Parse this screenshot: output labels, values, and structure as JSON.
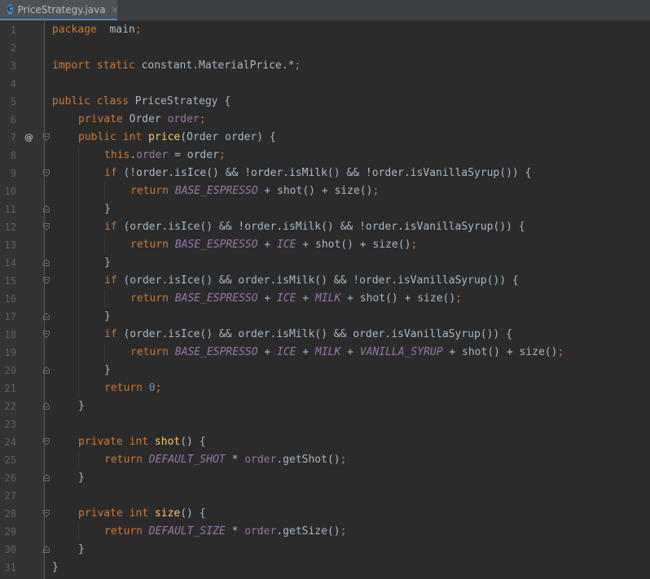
{
  "tab": {
    "icon_letter": "C",
    "title": "PriceStrategy.java",
    "close": "×"
  },
  "gutter": {
    "override_marker": "@"
  },
  "colors": {
    "background": "#2b2b2b",
    "keyword": "#cc7832",
    "method": "#ffc66d",
    "field": "#9876aa",
    "number": "#6897bb",
    "text": "#a9b7c6"
  },
  "lines": [
    {
      "n": "1",
      "indent": 0,
      "tokens": [
        [
          "kw",
          "package"
        ],
        [
          "",
          "  main"
        ],
        [
          "sym",
          ";"
        ]
      ]
    },
    {
      "n": "2",
      "indent": 0,
      "tokens": []
    },
    {
      "n": "3",
      "indent": 0,
      "tokens": [
        [
          "kw",
          "import static"
        ],
        [
          "",
          " constant.MaterialPrice.*"
        ],
        [
          "sym",
          ";"
        ]
      ]
    },
    {
      "n": "4",
      "indent": 0,
      "tokens": []
    },
    {
      "n": "5",
      "indent": 0,
      "tokens": [
        [
          "kw",
          "public class"
        ],
        [
          "",
          " PriceStrategy {"
        ]
      ]
    },
    {
      "n": "6",
      "indent": 1,
      "tokens": [
        [
          "kw",
          "private"
        ],
        [
          "",
          " Order "
        ],
        [
          "fld",
          "order"
        ],
        [
          "sym",
          ";"
        ]
      ]
    },
    {
      "n": "7",
      "indent": 1,
      "marker": "@",
      "fold": "open",
      "tokens": [
        [
          "kw",
          "public int"
        ],
        [
          "",
          " "
        ],
        [
          "fn",
          "price"
        ],
        [
          "",
          "(Order order) {"
        ]
      ]
    },
    {
      "n": "8",
      "indent": 2,
      "tokens": [
        [
          "kw",
          "this"
        ],
        [
          "",
          "."
        ],
        [
          "fld",
          "order"
        ],
        [
          "",
          " = order"
        ],
        [
          "sym",
          ";"
        ]
      ]
    },
    {
      "n": "9",
      "indent": 2,
      "fold": "open",
      "tokens": [
        [
          "kw",
          "if"
        ],
        [
          "",
          " (!order.isIce() && !order.isMilk() && !order.isVanillaSyrup()) {"
        ]
      ]
    },
    {
      "n": "10",
      "indent": 3,
      "tokens": [
        [
          "kw",
          "return"
        ],
        [
          "",
          " "
        ],
        [
          "const",
          "BASE_ESPRESSO"
        ],
        [
          "",
          " + shot() + size()"
        ],
        [
          "sym",
          ";"
        ]
      ]
    },
    {
      "n": "11",
      "indent": 2,
      "fold": "close",
      "tokens": [
        [
          "",
          "}"
        ]
      ]
    },
    {
      "n": "12",
      "indent": 2,
      "fold": "open",
      "tokens": [
        [
          "kw",
          "if"
        ],
        [
          "",
          " (order.isIce() && !order.isMilk() && !order.isVanillaSyrup()) {"
        ]
      ]
    },
    {
      "n": "13",
      "indent": 3,
      "tokens": [
        [
          "kw",
          "return"
        ],
        [
          "",
          " "
        ],
        [
          "const",
          "BASE_ESPRESSO"
        ],
        [
          "",
          " + "
        ],
        [
          "const",
          "ICE"
        ],
        [
          "",
          " + shot() + size()"
        ],
        [
          "sym",
          ";"
        ]
      ]
    },
    {
      "n": "14",
      "indent": 2,
      "fold": "close",
      "tokens": [
        [
          "",
          "}"
        ]
      ]
    },
    {
      "n": "15",
      "indent": 2,
      "fold": "open",
      "tokens": [
        [
          "kw",
          "if"
        ],
        [
          "",
          " (order.isIce() && order.isMilk() && !order.isVanillaSyrup()) {"
        ]
      ]
    },
    {
      "n": "16",
      "indent": 3,
      "tokens": [
        [
          "kw",
          "return"
        ],
        [
          "",
          " "
        ],
        [
          "const",
          "BASE_ESPRESSO"
        ],
        [
          "",
          " + "
        ],
        [
          "const",
          "ICE"
        ],
        [
          "",
          " + "
        ],
        [
          "const",
          "MILK"
        ],
        [
          "",
          " + shot() + size()"
        ],
        [
          "sym",
          ";"
        ]
      ]
    },
    {
      "n": "17",
      "indent": 2,
      "fold": "close",
      "tokens": [
        [
          "",
          "}"
        ]
      ]
    },
    {
      "n": "18",
      "indent": 2,
      "fold": "open",
      "tokens": [
        [
          "kw",
          "if"
        ],
        [
          "",
          " (order.isIce() && order.isMilk() && order.isVanillaSyrup()) {"
        ]
      ]
    },
    {
      "n": "19",
      "indent": 3,
      "tokens": [
        [
          "kw",
          "return"
        ],
        [
          "",
          " "
        ],
        [
          "const",
          "BASE_ESPRESSO"
        ],
        [
          "",
          " + "
        ],
        [
          "const",
          "ICE"
        ],
        [
          "",
          " + "
        ],
        [
          "const",
          "MILK"
        ],
        [
          "",
          " + "
        ],
        [
          "const",
          "VANILLA_SYRUP"
        ],
        [
          "",
          " + shot() + size()"
        ],
        [
          "sym",
          ";"
        ]
      ]
    },
    {
      "n": "20",
      "indent": 2,
      "fold": "close",
      "tokens": [
        [
          "",
          "}"
        ]
      ]
    },
    {
      "n": "21",
      "indent": 2,
      "tokens": [
        [
          "kw",
          "return"
        ],
        [
          "",
          " "
        ],
        [
          "num",
          "0"
        ],
        [
          "sym",
          ";"
        ]
      ]
    },
    {
      "n": "22",
      "indent": 1,
      "fold": "close",
      "tokens": [
        [
          "",
          "}"
        ]
      ]
    },
    {
      "n": "23",
      "indent": 0,
      "tokens": []
    },
    {
      "n": "24",
      "indent": 1,
      "fold": "open",
      "tokens": [
        [
          "kw",
          "private int"
        ],
        [
          "",
          " "
        ],
        [
          "fn",
          "shot"
        ],
        [
          "",
          "() {"
        ]
      ]
    },
    {
      "n": "25",
      "indent": 2,
      "tokens": [
        [
          "kw",
          "return"
        ],
        [
          "",
          " "
        ],
        [
          "const",
          "DEFAULT_SHOT"
        ],
        [
          "",
          " * "
        ],
        [
          "fld",
          "order"
        ],
        [
          "",
          ".getShot()"
        ],
        [
          "sym",
          ";"
        ]
      ]
    },
    {
      "n": "26",
      "indent": 1,
      "fold": "close",
      "tokens": [
        [
          "",
          "}"
        ]
      ]
    },
    {
      "n": "27",
      "indent": 0,
      "tokens": []
    },
    {
      "n": "28",
      "indent": 1,
      "fold": "open",
      "tokens": [
        [
          "kw",
          "private int"
        ],
        [
          "",
          " "
        ],
        [
          "fn",
          "size"
        ],
        [
          "",
          "() {"
        ]
      ]
    },
    {
      "n": "29",
      "indent": 2,
      "tokens": [
        [
          "kw",
          "return"
        ],
        [
          "",
          " "
        ],
        [
          "const",
          "DEFAULT_SIZE"
        ],
        [
          "",
          " * "
        ],
        [
          "fld",
          "order"
        ],
        [
          "",
          ".getSize()"
        ],
        [
          "sym",
          ";"
        ]
      ]
    },
    {
      "n": "30",
      "indent": 1,
      "fold": "close",
      "tokens": [
        [
          "",
          "}"
        ]
      ]
    },
    {
      "n": "31",
      "indent": 0,
      "tokens": [
        [
          "",
          "}"
        ]
      ]
    }
  ]
}
